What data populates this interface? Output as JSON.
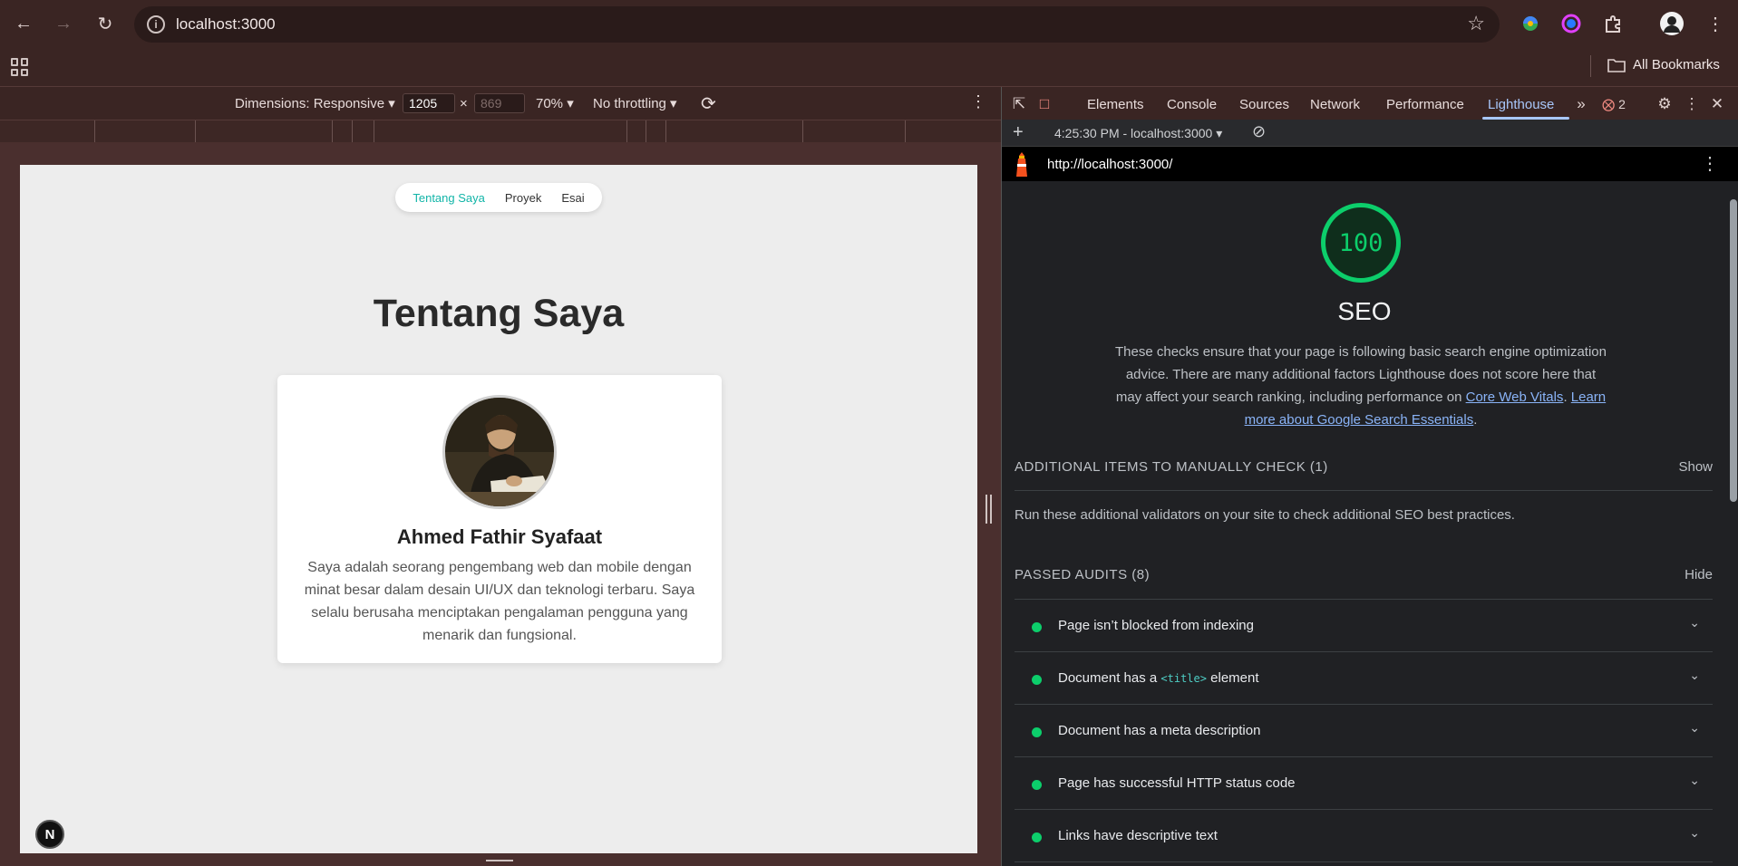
{
  "browser": {
    "url": "localhost:3000",
    "bookmarks_label": "All Bookmarks"
  },
  "device_toolbar": {
    "dimensions_label": "Dimensions: Responsive",
    "width": "1205",
    "height_placeholder": "869",
    "zoom": "70%",
    "throttling": "No throttling"
  },
  "site": {
    "nav": [
      "Tentang Saya",
      "Proyek",
      "Esai"
    ],
    "heading": "Tentang Saya",
    "name": "Ahmed Fathir Syafaat",
    "bio": "Saya adalah seorang pengembang web dan mobile dengan minat besar dalam desain UI/UX dan teknologi terbaru. Saya selalu berusaha menciptakan pengalaman pengguna yang menarik dan fungsional.",
    "badge": "N"
  },
  "devtools": {
    "tabs": [
      "Elements",
      "Console",
      "Sources",
      "Network",
      "Performance",
      "Lighthouse"
    ],
    "active_tab": "Lighthouse",
    "error_count": "2",
    "report_label": "4:25:30 PM - localhost:3000",
    "report_url": "http://localhost:3000/",
    "score": "100",
    "category": "SEO",
    "description": "These checks ensure that your page is following basic search engine optimization advice. There are many additional factors Lighthouse does not score here that may affect your search ranking, including performance on",
    "link1": "Core Web Vitals",
    "link2": "Learn more about Google Search Essentials",
    "manual_title": "ADDITIONAL ITEMS TO MANUALLY CHECK (1)",
    "manual_toggle": "Show",
    "manual_desc": "Run these additional validators on your site to check additional SEO best practices.",
    "passed_title": "PASSED AUDITS (8)",
    "passed_toggle": "Hide",
    "audits": [
      {
        "before": "Page isn’t blocked from indexing"
      },
      {
        "before": "Document has a ",
        "code": "<title>",
        "after": " element"
      },
      {
        "before": "Document has a meta description"
      },
      {
        "before": "Page has successful HTTP status code"
      },
      {
        "before": "Links have descriptive text"
      }
    ]
  },
  "colors": {
    "accent_teal": "#12b5a8",
    "pass_green": "#0cce6b",
    "devtools_link": "#8ab4f8"
  }
}
